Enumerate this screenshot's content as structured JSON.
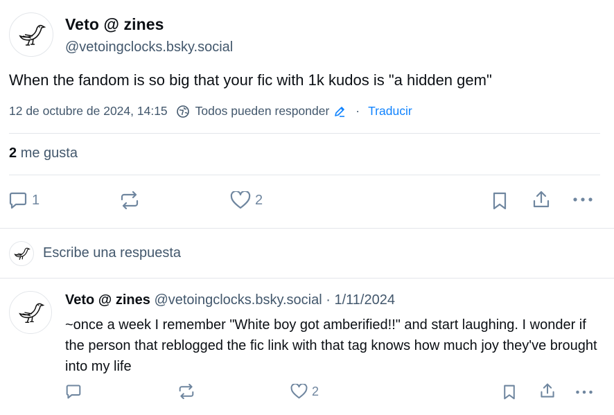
{
  "post": {
    "author_name": "Veto @ zines",
    "author_handle": "@vetoingclocks.bsky.social",
    "text": "When the fandom is so big that your fic with 1k kudos is \"a hidden gem\"",
    "timestamp": "12 de octubre de 2024, 14:15",
    "reply_setting": "Todos pueden responder",
    "separator": "·",
    "translate_label": "Traducir",
    "likes_count": "2",
    "likes_label": "me gusta",
    "actions": {
      "reply_count": "1",
      "repost_count": "",
      "like_count": "2"
    }
  },
  "reply_composer": {
    "placeholder": "Escribe una respuesta"
  },
  "reply": {
    "author_name": "Veto @ zines",
    "author_handle": "@vetoingclocks.bsky.social",
    "separator": "·",
    "date": "1/11/2024",
    "text": "~once a week I remember \"White boy got amberified!!\" and start laughing. I wonder if the person that reblogged the fic link with that tag knows how much joy they've brought into my life",
    "actions": {
      "reply_count": "",
      "repost_count": "",
      "like_count": "2"
    }
  },
  "colors": {
    "text": "#0b0f14",
    "muted": "#42576c",
    "icon": "#6f869f",
    "link": "#1083fe",
    "divider": "#e3e6ea"
  },
  "icons": [
    "bird-avatar",
    "globe-icon",
    "pencil-icon",
    "reply-icon",
    "repost-icon",
    "heart-icon",
    "bookmark-icon",
    "share-icon",
    "more-icon"
  ]
}
